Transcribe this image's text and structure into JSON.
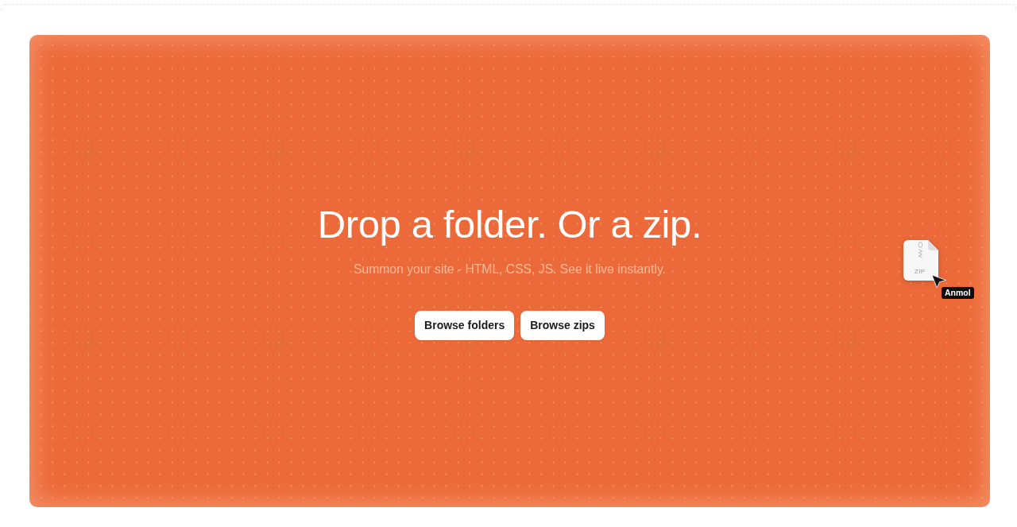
{
  "hero": {
    "title": "Drop a folder. Or a zip.",
    "subtitle": "Summon your site - HTML, CSS, JS. See it live instantly.",
    "buttons": [
      {
        "label": "Browse folders"
      },
      {
        "label": "Browse zips"
      }
    ]
  },
  "drag_preview": {
    "file_label": "ZIP",
    "cursor_name": "Anmol"
  }
}
